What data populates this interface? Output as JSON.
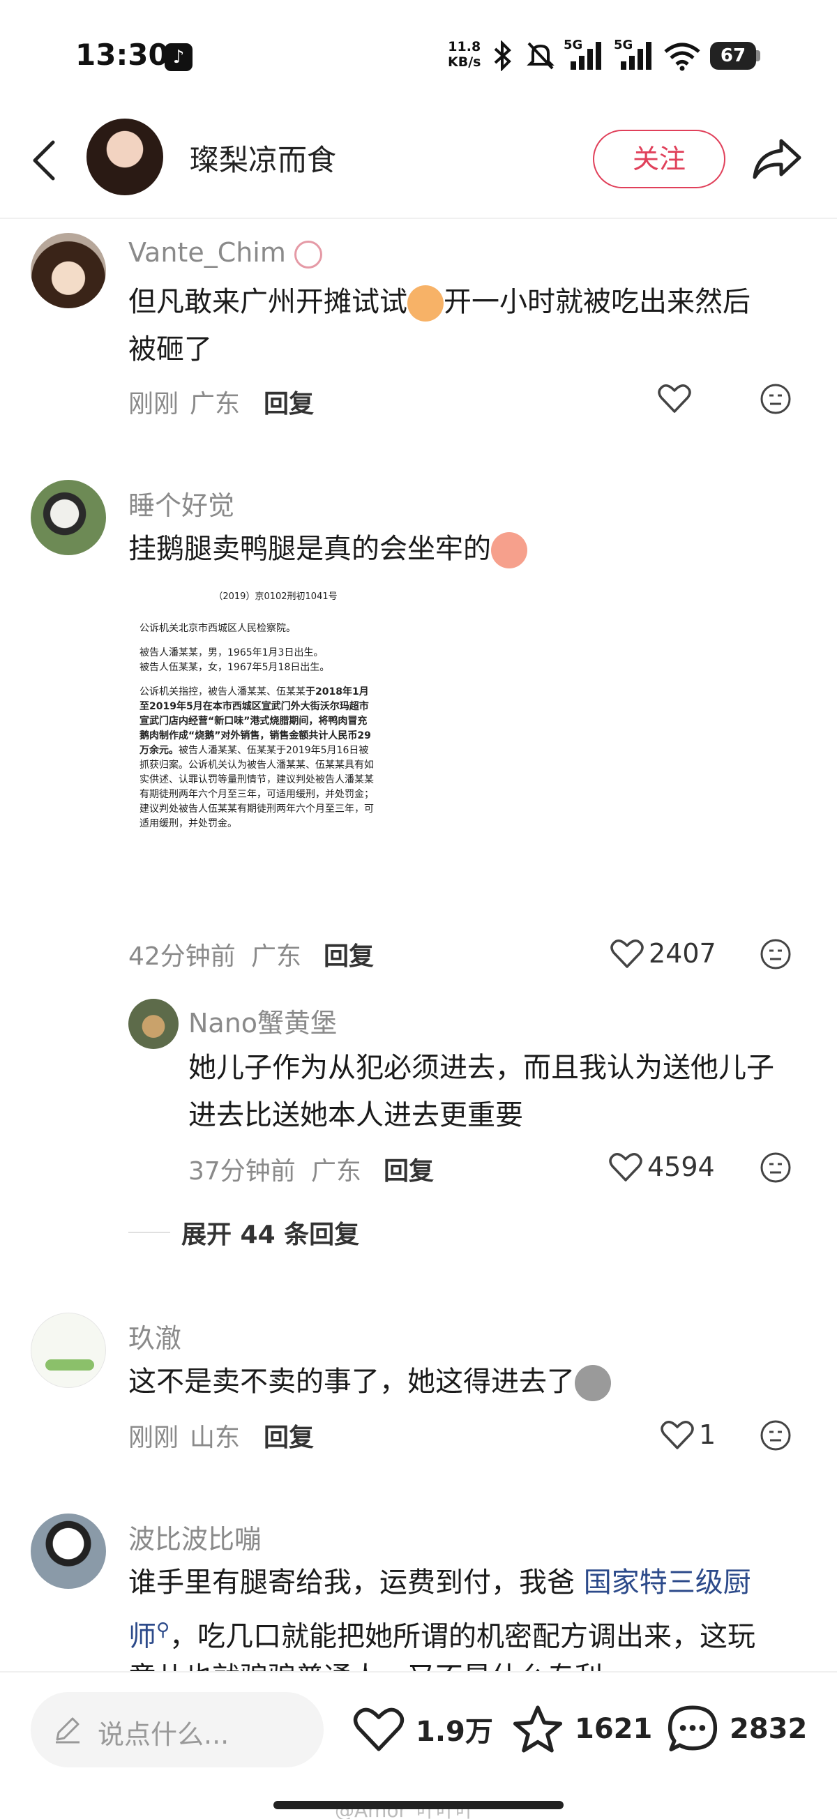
{
  "status_bar": {
    "time": "13:30",
    "net_speed_value": "11.8",
    "net_speed_unit": "KB/s",
    "signal1_label": "5G",
    "signal2_label": "5G",
    "battery": "67"
  },
  "header": {
    "title": "璨梨凉而食",
    "follow_label": "关注"
  },
  "comments": [
    {
      "username": "Vante_Chim",
      "text_line1_a": "但凡敢来广州开摊试试",
      "text_line1_b": "开一小时就被吃出来然后",
      "text_line2": "被砸了",
      "time": "刚刚",
      "location": "广东",
      "reply_label": "回复"
    },
    {
      "username": "睡个好觉",
      "text_a": "挂鹅腿卖鸭腿是真的会坐牢的",
      "time": "42分钟前",
      "location": "广东",
      "reply_label": "回复",
      "likes": "2407",
      "document": {
        "title": "（2019）京0102刑初1041号",
        "p1": "公诉机关北京市西城区人民检察院。",
        "p2a": "被告人潘某某，男，1965年1月3日出生。",
        "p2b": "被告人伍某某，女，1967年5月18日出生。",
        "p3a": "公诉机关指控，被告人潘某某、伍某某",
        "p3b": "于2018年1月至2019年5月在本市西城区宣武门外大街沃尔玛超市宣武门店内经营“新口味”港式烧腊期间，将鸭肉冒充鹅肉制作成“烧鹅”对外销售，销售金额共计人民币29万余元。",
        "p3c": "被告人潘某某、伍某某于2019年5月16日被抓获归案。公诉机关认为被告人潘某某、伍某某具有如实供述、认罪认罚等量刑情节，建议判处被告人潘某某有期徒刑两年六个月至三年，可适用缓刑，并处罚金；建议判处被告人伍某某有期徒刑两年六个月至三年，可适用缓刑，并处罚金。"
      },
      "reply": {
        "username": "Nano蟹黄堡",
        "text_line1": "她儿子作为从犯必须进去，而且我认为送他儿子",
        "text_line2": "进去比送她本人进去更重要",
        "time": "37分钟前",
        "location": "广东",
        "reply_label": "回复",
        "likes": "4594"
      },
      "expand_label": "展开 44 条回复"
    },
    {
      "username": "玖澈",
      "text_a": "这不是卖不卖的事了，她这得进去了",
      "time": "刚刚",
      "location": "山东",
      "reply_label": "回复",
      "likes": "1"
    },
    {
      "username": "波比波比嘣",
      "text_line1_a": "谁手里有腿寄给我，运费到付，我爸",
      "text_line1_link": "国家特三级厨",
      "text_line2_link": "师",
      "text_line2_b": "，吃几口就能把她所谓的机密配方调出来，这玩",
      "text_line3": "意儿也就骗骗普通人，又不是什么专利"
    }
  ],
  "bottom_bar": {
    "input_placeholder": "说点什么...",
    "likes": "1.9万",
    "favorites": "1621",
    "comments": "2832",
    "watermark": "@Amor_叶叶叶"
  },
  "colors": {
    "accent": "#e0405a",
    "link": "#2c4a8a",
    "muted": "#8a8a8a"
  }
}
